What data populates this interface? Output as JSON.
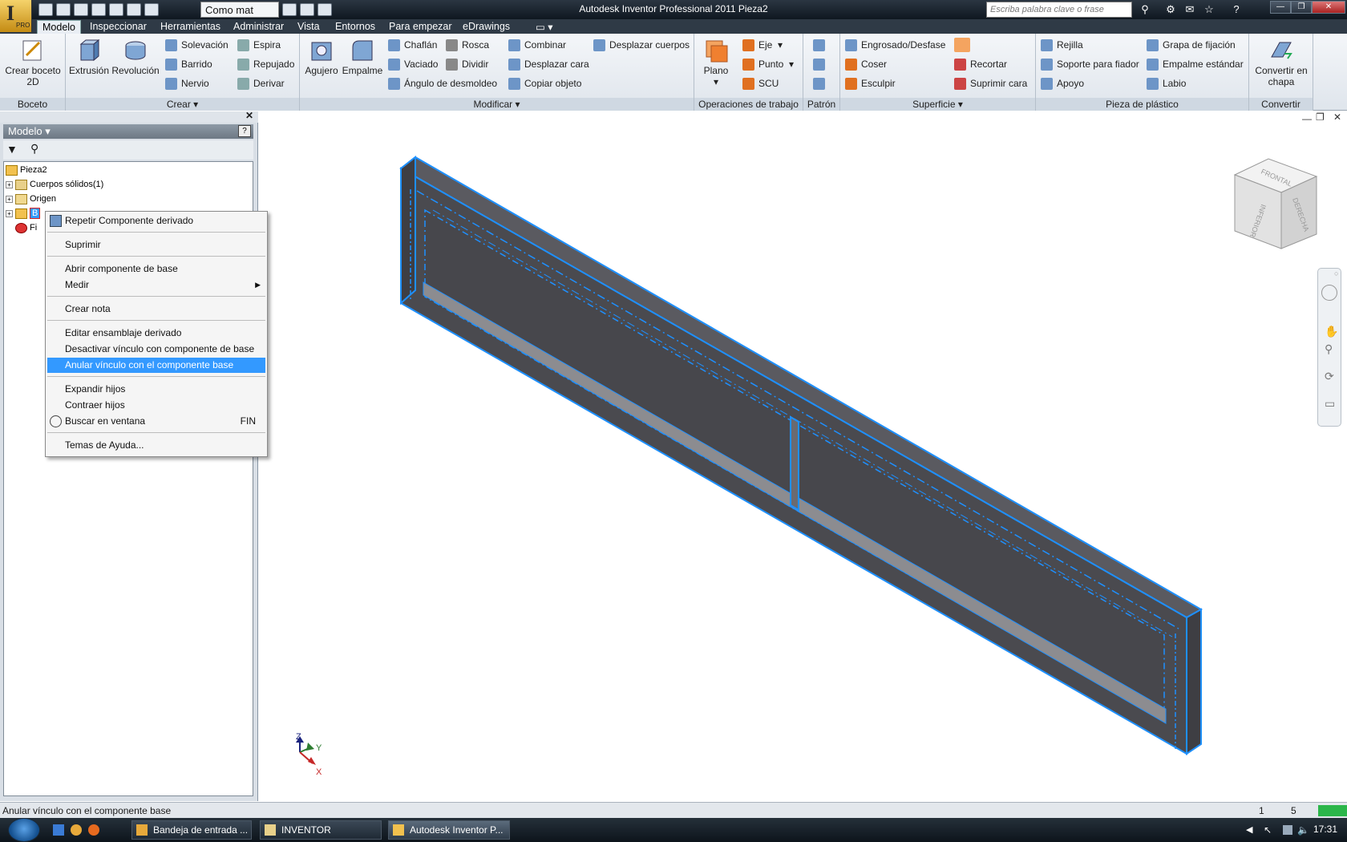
{
  "window": {
    "title": "Autodesk Inventor Professional 2011    Pieza2",
    "app_button_badge": "PRO",
    "qat_select_value": "Como mat",
    "help_search_placeholder": "Escriba palabra clave o frase"
  },
  "tabs": [
    {
      "label": "Modelo",
      "active": true
    },
    {
      "label": "Inspeccionar"
    },
    {
      "label": "Herramientas"
    },
    {
      "label": "Administrar"
    },
    {
      "label": "Vista"
    },
    {
      "label": "Entornos"
    },
    {
      "label": "Para empezar"
    },
    {
      "label": "eDrawings"
    }
  ],
  "ribbon": {
    "groups": {
      "boceto": "Boceto",
      "crear": "Crear",
      "modificar": "Modificar",
      "operaciones": "Operaciones de trabajo",
      "patron": "Patrón",
      "superficie": "Superficie",
      "plastico": "Pieza de plástico",
      "convertir": "Convertir"
    },
    "crear_boceto": "Crear boceto 2D",
    "extrusion": "Extrusión",
    "revolucion": "Revolución",
    "solevacion": "Solevación",
    "barrido": "Barrido",
    "nervio": "Nervio",
    "espira": "Espira",
    "repujado": "Repujado",
    "derivar": "Derivar",
    "agujero": "Agujero",
    "empalme": "Empalme",
    "chaflan": "Chaflán",
    "vaciado": "Vaciado",
    "angulo": "Ángulo de desmoldeo",
    "rosca": "Rosca",
    "dividir": "Dividir",
    "combinar": "Combinar",
    "desplazar_cara": "Desplazar cara",
    "copiar_objeto": "Copiar objeto",
    "desplazar_cuerpos": "Desplazar cuerpos",
    "plano": "Plano",
    "eje": "Eje",
    "punto": "Punto",
    "scu": "SCU",
    "engrosado": "Engrosado/Desfase",
    "coser": "Coser",
    "esculpir": "Esculpir",
    "recortar": "Recortar",
    "suprimir_cara": "Suprimir cara",
    "rejilla": "Rejilla",
    "soporte": "Soporte para fiador",
    "apoyo": "Apoyo",
    "grapa": "Grapa de fijación",
    "empalme_estandar": "Empalme estándar",
    "labio": "Labio",
    "convertir_chapa": "Convertir en chapa"
  },
  "browser": {
    "header": "Modelo",
    "tree": [
      {
        "label": "Pieza2"
      },
      {
        "label": "Cuerpos sólidos(1)"
      },
      {
        "label": "Origen"
      },
      {
        "label": "B"
      },
      {
        "label": "Fi"
      }
    ]
  },
  "context_menu": {
    "items": [
      {
        "label": "Repetir Componente derivado"
      },
      {
        "label": "Suprimir"
      },
      {
        "label": "Abrir componente de base"
      },
      {
        "label": "Medir"
      },
      {
        "label": "Crear nota"
      },
      {
        "label": "Editar ensamblaje derivado"
      },
      {
        "label": "Desactivar vínculo con componente de base"
      },
      {
        "label": "Anular vínculo con el componente base",
        "highlighted": true
      },
      {
        "label": "Expandir hijos"
      },
      {
        "label": "Contraer hijos"
      },
      {
        "label": "Buscar en ventana",
        "shortcut": "FIN"
      },
      {
        "label": "Temas de Ayuda..."
      }
    ]
  },
  "viewcube": {
    "frontal": "FRONTAL",
    "derecha": "DERECHA",
    "inferior": "INFERIOR"
  },
  "axes": {
    "z": "Z",
    "y": "Y",
    "x": "X"
  },
  "statusbar": {
    "text": "Anular vínculo con el componente base",
    "n1": "1",
    "n2": "5"
  },
  "taskbar": {
    "tasks": [
      {
        "label": "Bandeja de entrada ..."
      },
      {
        "label": "INVENTOR"
      },
      {
        "label": "Autodesk Inventor P...",
        "active": true
      }
    ],
    "clock": "17:31"
  },
  "colors": {
    "highlight": "#3399ff",
    "selection_edges": "#1e90ff",
    "model_face": "#4a4a4f",
    "title_bar": "#1c2631"
  }
}
